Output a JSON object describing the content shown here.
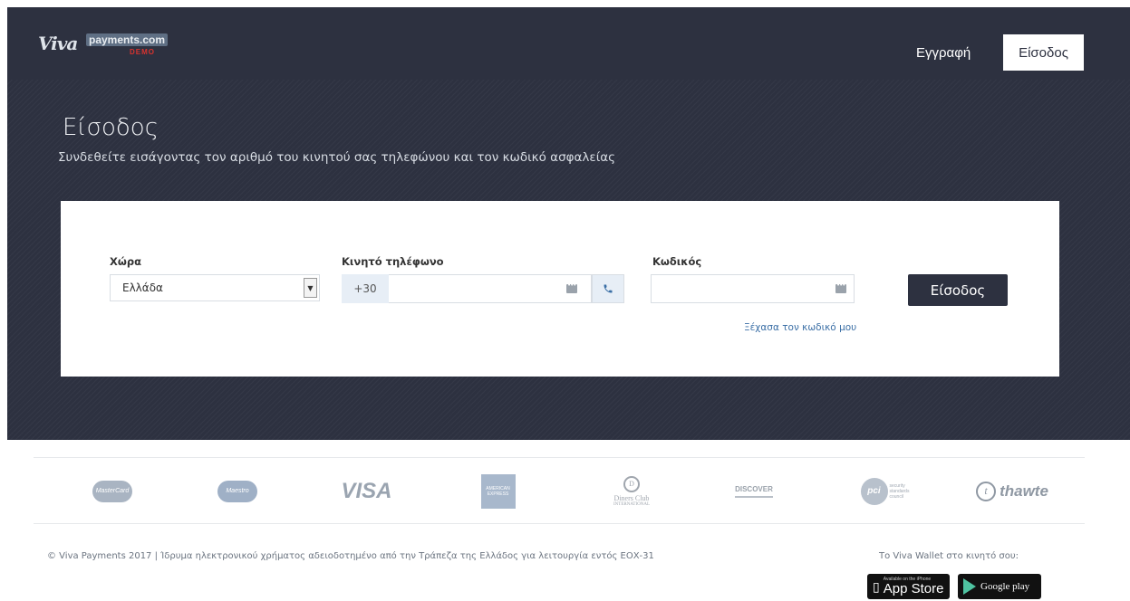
{
  "header": {
    "logo": {
      "mark": "Viva",
      "payments": "payments.com",
      "demo": "DEMO"
    },
    "nav": {
      "register": "Εγγραφή",
      "login": "Είσοδος"
    }
  },
  "hero": {
    "title": "Είσοδος",
    "subtitle": "Συνδεθείτε εισάγοντας τον αριθμό του κινητού σας τηλεφώνου και τον κωδικό ασφαλείας"
  },
  "form": {
    "country": {
      "label": "Χώρα",
      "value": "Ελλάδα"
    },
    "phone": {
      "label": "Κινητό τηλέφωνο",
      "prefix": "+30",
      "value": ""
    },
    "password": {
      "label": "Κωδικός",
      "value": ""
    },
    "forgot_link": "Ξέχασα τον κωδικό μου",
    "submit_label": "Είσοδος"
  },
  "payment_logos": {
    "mastercard": "MasterCard",
    "maestro": "Maestro",
    "visa": "VISA",
    "amex": "AMERICAN EXPRESS",
    "diners_mark": "D",
    "diners": "Diners Club",
    "diners_sub": "INTERNATIONAL",
    "discover": "DISCOVER",
    "pci": "pci",
    "pci_sub": "security standards council",
    "thawte_mark": "t",
    "thawte": "thawte"
  },
  "footer": {
    "copyright": "© Viva Payments 2017 | Ίδρυμα ηλεκτρονικού χρήματος αδειοδοτημένο από την Τράπεζα της Ελλάδος για λειτουργία εντός ΕΟΧ-31",
    "wallet_label": "Το Viva Wallet στο κινητό σου:",
    "appstore": {
      "small": "Available on the iPhone",
      "big": "App Store"
    },
    "googleplay": {
      "big": "Google play"
    }
  },
  "colors": {
    "hero_bg": "#2d3140",
    "button_bg": "#2d3140",
    "prefix_bg": "#e7eef6",
    "link": "#3a6ea5"
  }
}
